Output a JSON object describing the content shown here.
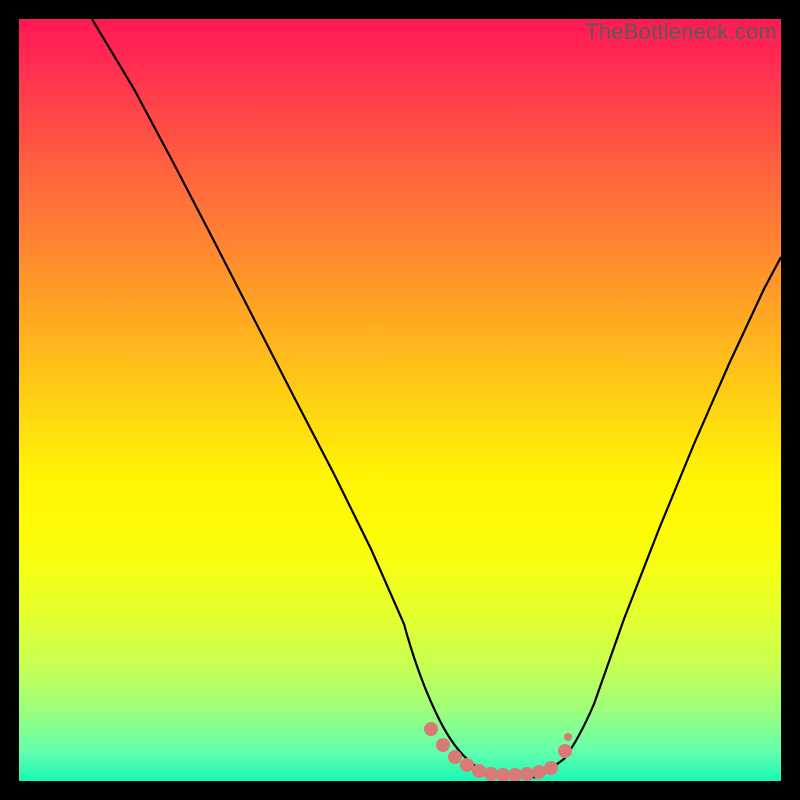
{
  "watermark": "TheBottleneck.com",
  "chart_data": {
    "type": "line",
    "title": "",
    "xlabel": "",
    "ylabel": "",
    "xlim": [
      0,
      100
    ],
    "ylim": [
      0,
      100
    ],
    "grid": false,
    "legend": false,
    "series": [
      {
        "name": "bottleneck-curve",
        "color": "#000000",
        "x": [
          10,
          15,
          20,
          25,
          30,
          35,
          40,
          45,
          50,
          52,
          55,
          58,
          60,
          63,
          65,
          68,
          70,
          75,
          80,
          85,
          90,
          95,
          100
        ],
        "y": [
          100,
          90,
          80,
          70,
          60,
          50,
          40,
          30,
          20,
          15,
          8,
          2,
          0,
          0,
          0,
          0,
          2,
          10,
          22,
          35,
          48,
          58,
          68
        ]
      },
      {
        "name": "optimal-range-marker",
        "color": "#d97a76",
        "x": [
          52,
          55,
          58,
          60,
          63,
          65,
          68,
          70,
          72
        ],
        "y": [
          5,
          3,
          1,
          0,
          0,
          0,
          1,
          3,
          6
        ]
      }
    ],
    "optimal_range_x": [
      55,
      70
    ],
    "background_gradient_stops": [
      {
        "pos": 0,
        "color": "#ff1955"
      },
      {
        "pos": 50,
        "color": "#ffd010"
      },
      {
        "pos": 100,
        "color": "#19f8b7"
      }
    ]
  }
}
